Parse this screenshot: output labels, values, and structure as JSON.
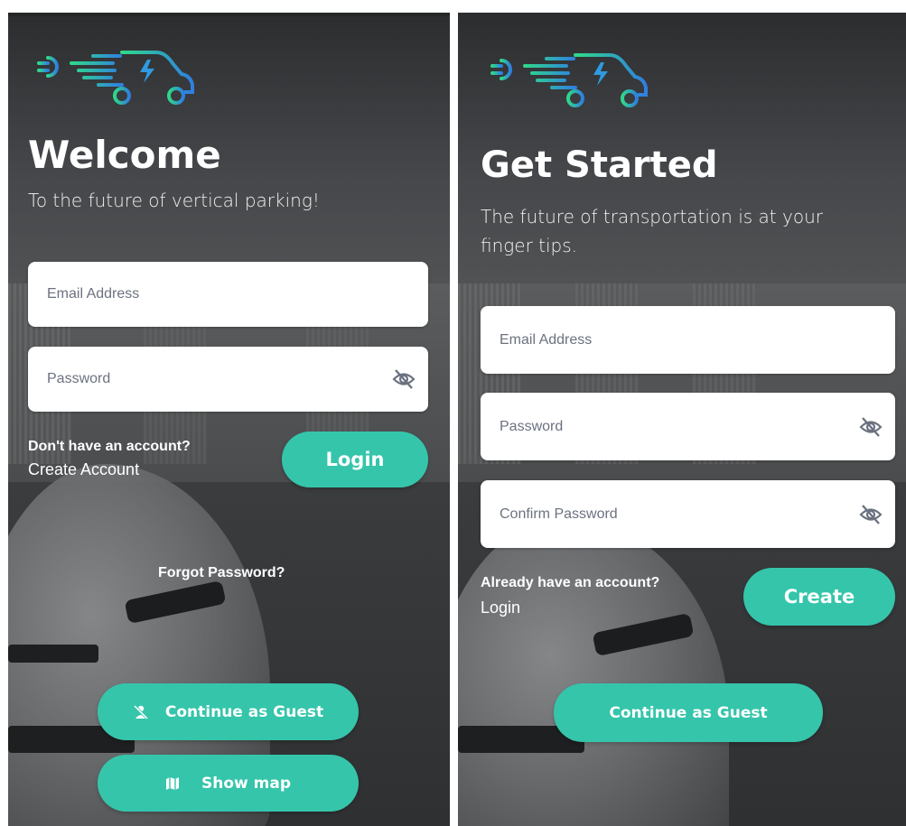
{
  "colors": {
    "accent": "#35c5ab",
    "logo_green": "#2fd98a",
    "logo_blue": "#2f7fe0"
  },
  "login_screen": {
    "title": "Welcome",
    "subtitle": "To the future of vertical parking!",
    "email_placeholder": "Email Address",
    "password_placeholder": "Password",
    "no_account_text": "Don't have an account?",
    "create_account_link": "Create Account",
    "login_button": "Login",
    "forgot_password": "Forgot Password?",
    "guest_button": "Continue as Guest",
    "guest_icon": "person-off-icon",
    "map_button": "Show map",
    "map_icon": "map-icon"
  },
  "signup_screen": {
    "title": "Get Started",
    "subtitle_line1": "The future of transportation is at your",
    "subtitle_line2": "finger tips.",
    "email_placeholder": "Email Address",
    "password_placeholder": "Password",
    "confirm_password_placeholder": "Confirm Password",
    "have_account_text": "Already have an account?",
    "login_link": "Login",
    "create_button": "Create",
    "guest_button": "Continue as Guest"
  }
}
